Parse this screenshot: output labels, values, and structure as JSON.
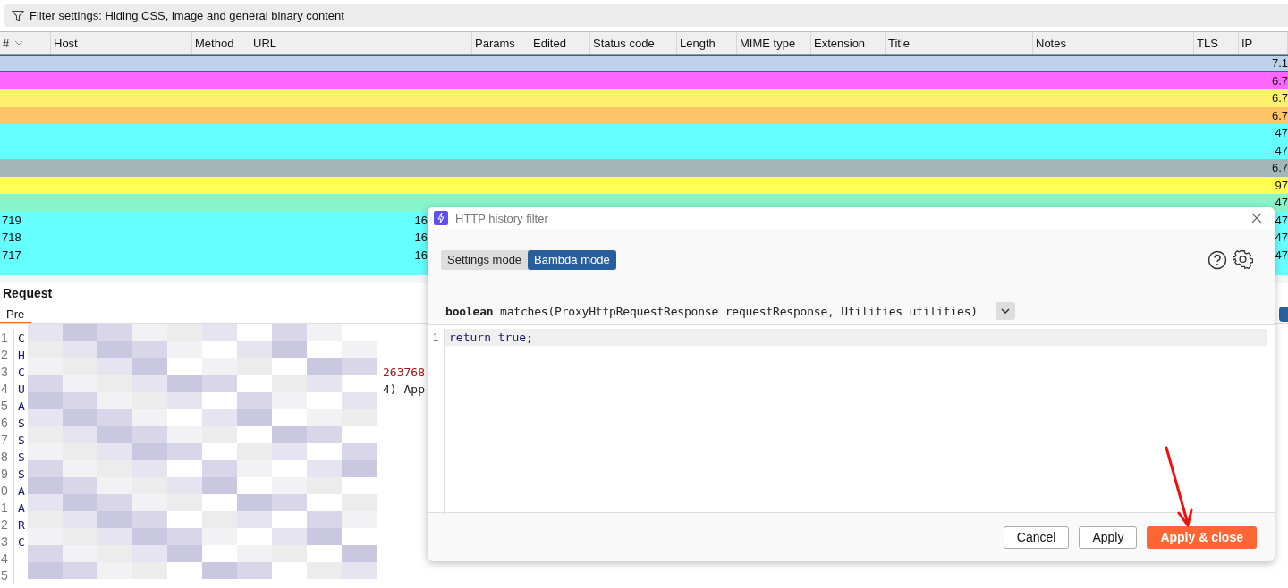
{
  "filter_bar": {
    "text": "Filter settings: Hiding CSS, image and general binary content"
  },
  "table": {
    "columns": [
      {
        "label": "#",
        "sorted": true
      },
      {
        "label": "Host",
        "sorted": false
      },
      {
        "label": "Method",
        "sorted": false
      },
      {
        "label": "URL",
        "sorted": false
      },
      {
        "label": "Params",
        "sorted": false
      },
      {
        "label": "Edited",
        "sorted": false
      },
      {
        "label": "Status code",
        "sorted": false
      },
      {
        "label": "Length",
        "sorted": false
      },
      {
        "label": "MIME type",
        "sorted": false
      },
      {
        "label": "Extension",
        "sorted": false
      },
      {
        "label": "Title",
        "sorted": false
      },
      {
        "label": "Notes",
        "sorted": false
      },
      {
        "label": "TLS",
        "sorted": false
      },
      {
        "label": "IP",
        "sorted": false
      }
    ],
    "rows": [
      {
        "ip": "7.1",
        "color": "#bdd1ea",
        "selected": true
      },
      {
        "ip": "6.7",
        "color": "#ff66ff",
        "selected": false
      },
      {
        "ip": "6.7",
        "color": "#fff06e",
        "selected": false
      },
      {
        "ip": "6.7",
        "color": "#fdc566",
        "selected": false
      },
      {
        "ip": "47",
        "color": "#66ffff",
        "selected": false
      },
      {
        "ip": "47",
        "color": "#66ffff",
        "selected": false
      },
      {
        "ip": "6.7",
        "color": "#a3b6b8",
        "selected": false
      },
      {
        "ip": "97",
        "color": "#ffff55",
        "selected": false
      },
      {
        "ip": "47",
        "color": "#86f5cc",
        "selected": false
      },
      {
        "number": "719",
        "url": "16",
        "ip": "47",
        "color": "#66ffff",
        "selected": false
      },
      {
        "number": "718",
        "url": "16",
        "ip": "47",
        "color": "#66ffff",
        "selected": false
      },
      {
        "number": "717",
        "url": "16",
        "ip": "47",
        "color": "#66ffff",
        "selected": false
      },
      {
        "color": "#66ffff",
        "selected": false
      }
    ]
  },
  "request": {
    "title": "Request",
    "tabs": [
      {
        "label": "Pre",
        "selected": true
      }
    ],
    "lines": [
      {
        "number": "1",
        "text": "C"
      },
      {
        "number": "2",
        "text": "H"
      },
      {
        "number": "3",
        "text": "C",
        "tail": {
          "text": "263768",
          "kind": "string"
        }
      },
      {
        "number": "4",
        "text": "U",
        "tail": {
          "text": "4) App",
          "kind": "plain"
        }
      },
      {
        "number": "5",
        "text": "A"
      },
      {
        "number": "6",
        "text": "S"
      },
      {
        "number": "7",
        "text": "S"
      },
      {
        "number": "8",
        "text": "S"
      },
      {
        "number": "9",
        "text": "S"
      },
      {
        "number": "0",
        "text": "A"
      },
      {
        "number": "1",
        "text": "A"
      },
      {
        "number": "2",
        "text": "R"
      },
      {
        "number": "3",
        "text": "C"
      },
      {
        "number": "4"
      },
      {
        "number": "5"
      }
    ]
  },
  "filter_dialog": {
    "title": "HTTP history filter",
    "modes": [
      {
        "label": "Settings mode",
        "selected": false
      },
      {
        "label": "Bambda mode",
        "selected": true
      }
    ],
    "signature": "**boolean** matches(ProxyHttpRequestResponse requestResponse, Utilities utilities)",
    "editor": {
      "lines": [
        {
          "number": "1",
          "code": "return true;"
        }
      ]
    },
    "buttons": [
      {
        "label": "Cancel",
        "kind": "secondary"
      },
      {
        "label": "Apply",
        "kind": "secondary"
      },
      {
        "label": "Apply & close",
        "kind": "primary"
      }
    ]
  }
}
